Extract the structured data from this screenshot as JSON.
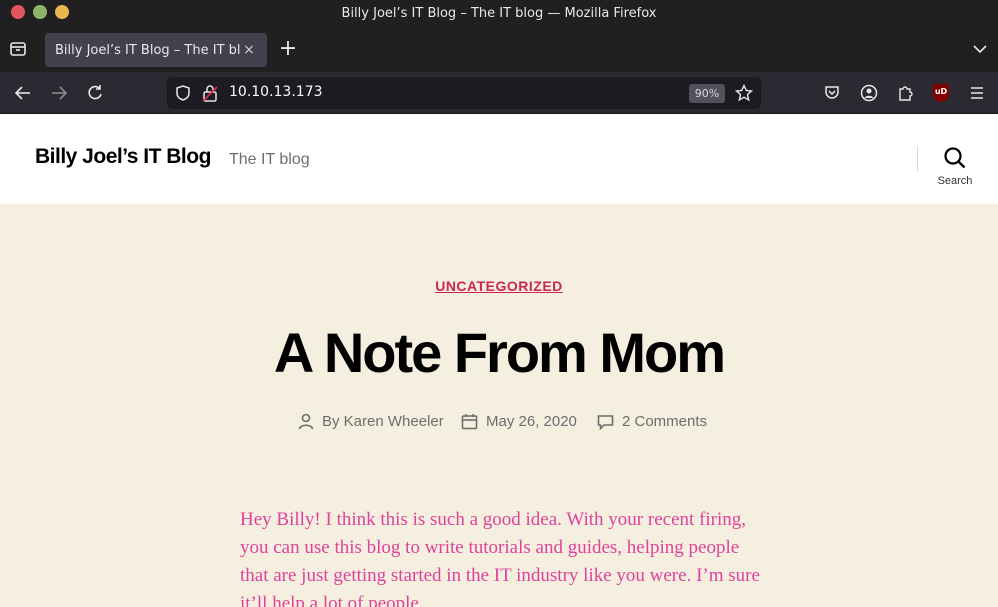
{
  "window": {
    "title": "Billy Joel’s IT Blog – The IT blog — Mozilla Firefox"
  },
  "tab": {
    "title": "Billy Joel’s IT Blog – The IT blog",
    "close_glyph": "×"
  },
  "new_tab_glyph": "+",
  "urlbar": {
    "url": "10.10.13.173",
    "zoom": "90%"
  },
  "toolbar": {
    "ublock_label": "uD"
  },
  "site": {
    "title": "Billy Joel’s IT Blog",
    "description": "The IT blog",
    "search_label": "Search"
  },
  "post": {
    "category": "UNCATEGORIZED",
    "title": "A Note From Mom",
    "author": "By Karen Wheeler",
    "date": "May 26, 2020",
    "comments": "2 Comments",
    "content": "Hey Billy!  I think this is such a good idea.  With your recent firing, you can use this blog to write tutorials and guides, helping people that are just getting started in the IT industry like you were.  I’m sure it’ll help a lot of people."
  },
  "colors": {
    "accent": "#cd2653",
    "content_text": "#e0429b",
    "page_background": "#f5efe0",
    "browser_chrome": "#2b2a33"
  }
}
